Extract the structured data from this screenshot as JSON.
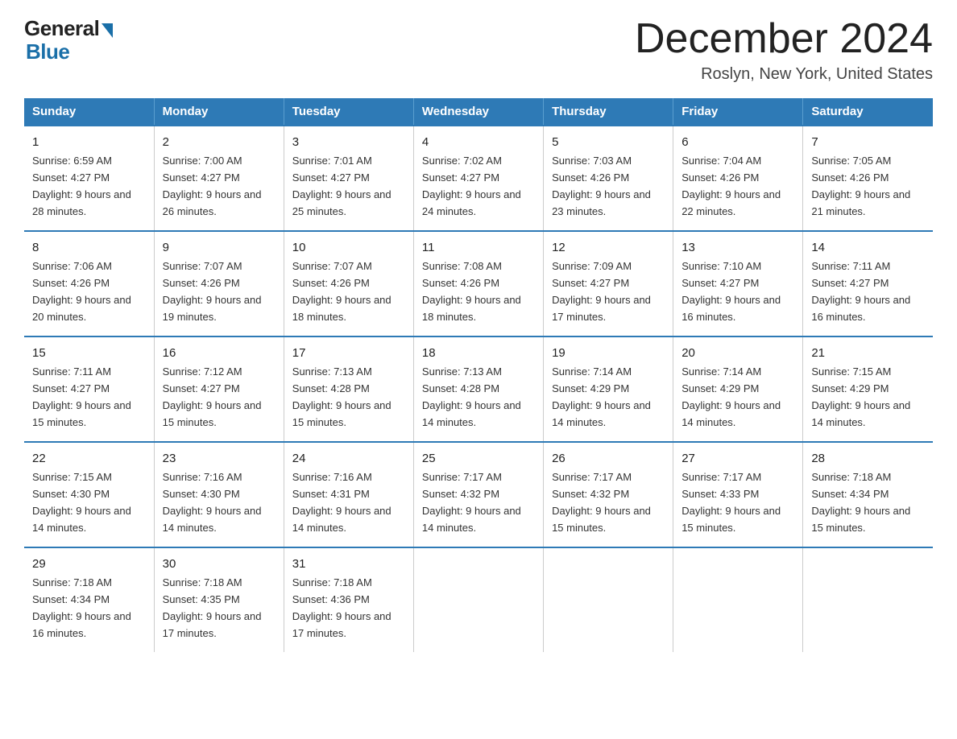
{
  "logo": {
    "text_general": "General",
    "text_blue": "Blue"
  },
  "title": "December 2024",
  "subtitle": "Roslyn, New York, United States",
  "days_of_week": [
    "Sunday",
    "Monday",
    "Tuesday",
    "Wednesday",
    "Thursday",
    "Friday",
    "Saturday"
  ],
  "weeks": [
    [
      {
        "day": "1",
        "sunrise": "Sunrise: 6:59 AM",
        "sunset": "Sunset: 4:27 PM",
        "daylight": "Daylight: 9 hours and 28 minutes."
      },
      {
        "day": "2",
        "sunrise": "Sunrise: 7:00 AM",
        "sunset": "Sunset: 4:27 PM",
        "daylight": "Daylight: 9 hours and 26 minutes."
      },
      {
        "day": "3",
        "sunrise": "Sunrise: 7:01 AM",
        "sunset": "Sunset: 4:27 PM",
        "daylight": "Daylight: 9 hours and 25 minutes."
      },
      {
        "day": "4",
        "sunrise": "Sunrise: 7:02 AM",
        "sunset": "Sunset: 4:27 PM",
        "daylight": "Daylight: 9 hours and 24 minutes."
      },
      {
        "day": "5",
        "sunrise": "Sunrise: 7:03 AM",
        "sunset": "Sunset: 4:26 PM",
        "daylight": "Daylight: 9 hours and 23 minutes."
      },
      {
        "day": "6",
        "sunrise": "Sunrise: 7:04 AM",
        "sunset": "Sunset: 4:26 PM",
        "daylight": "Daylight: 9 hours and 22 minutes."
      },
      {
        "day": "7",
        "sunrise": "Sunrise: 7:05 AM",
        "sunset": "Sunset: 4:26 PM",
        "daylight": "Daylight: 9 hours and 21 minutes."
      }
    ],
    [
      {
        "day": "8",
        "sunrise": "Sunrise: 7:06 AM",
        "sunset": "Sunset: 4:26 PM",
        "daylight": "Daylight: 9 hours and 20 minutes."
      },
      {
        "day": "9",
        "sunrise": "Sunrise: 7:07 AM",
        "sunset": "Sunset: 4:26 PM",
        "daylight": "Daylight: 9 hours and 19 minutes."
      },
      {
        "day": "10",
        "sunrise": "Sunrise: 7:07 AM",
        "sunset": "Sunset: 4:26 PM",
        "daylight": "Daylight: 9 hours and 18 minutes."
      },
      {
        "day": "11",
        "sunrise": "Sunrise: 7:08 AM",
        "sunset": "Sunset: 4:26 PM",
        "daylight": "Daylight: 9 hours and 18 minutes."
      },
      {
        "day": "12",
        "sunrise": "Sunrise: 7:09 AM",
        "sunset": "Sunset: 4:27 PM",
        "daylight": "Daylight: 9 hours and 17 minutes."
      },
      {
        "day": "13",
        "sunrise": "Sunrise: 7:10 AM",
        "sunset": "Sunset: 4:27 PM",
        "daylight": "Daylight: 9 hours and 16 minutes."
      },
      {
        "day": "14",
        "sunrise": "Sunrise: 7:11 AM",
        "sunset": "Sunset: 4:27 PM",
        "daylight": "Daylight: 9 hours and 16 minutes."
      }
    ],
    [
      {
        "day": "15",
        "sunrise": "Sunrise: 7:11 AM",
        "sunset": "Sunset: 4:27 PM",
        "daylight": "Daylight: 9 hours and 15 minutes."
      },
      {
        "day": "16",
        "sunrise": "Sunrise: 7:12 AM",
        "sunset": "Sunset: 4:27 PM",
        "daylight": "Daylight: 9 hours and 15 minutes."
      },
      {
        "day": "17",
        "sunrise": "Sunrise: 7:13 AM",
        "sunset": "Sunset: 4:28 PM",
        "daylight": "Daylight: 9 hours and 15 minutes."
      },
      {
        "day": "18",
        "sunrise": "Sunrise: 7:13 AM",
        "sunset": "Sunset: 4:28 PM",
        "daylight": "Daylight: 9 hours and 14 minutes."
      },
      {
        "day": "19",
        "sunrise": "Sunrise: 7:14 AM",
        "sunset": "Sunset: 4:29 PM",
        "daylight": "Daylight: 9 hours and 14 minutes."
      },
      {
        "day": "20",
        "sunrise": "Sunrise: 7:14 AM",
        "sunset": "Sunset: 4:29 PM",
        "daylight": "Daylight: 9 hours and 14 minutes."
      },
      {
        "day": "21",
        "sunrise": "Sunrise: 7:15 AM",
        "sunset": "Sunset: 4:29 PM",
        "daylight": "Daylight: 9 hours and 14 minutes."
      }
    ],
    [
      {
        "day": "22",
        "sunrise": "Sunrise: 7:15 AM",
        "sunset": "Sunset: 4:30 PM",
        "daylight": "Daylight: 9 hours and 14 minutes."
      },
      {
        "day": "23",
        "sunrise": "Sunrise: 7:16 AM",
        "sunset": "Sunset: 4:30 PM",
        "daylight": "Daylight: 9 hours and 14 minutes."
      },
      {
        "day": "24",
        "sunrise": "Sunrise: 7:16 AM",
        "sunset": "Sunset: 4:31 PM",
        "daylight": "Daylight: 9 hours and 14 minutes."
      },
      {
        "day": "25",
        "sunrise": "Sunrise: 7:17 AM",
        "sunset": "Sunset: 4:32 PM",
        "daylight": "Daylight: 9 hours and 14 minutes."
      },
      {
        "day": "26",
        "sunrise": "Sunrise: 7:17 AM",
        "sunset": "Sunset: 4:32 PM",
        "daylight": "Daylight: 9 hours and 15 minutes."
      },
      {
        "day": "27",
        "sunrise": "Sunrise: 7:17 AM",
        "sunset": "Sunset: 4:33 PM",
        "daylight": "Daylight: 9 hours and 15 minutes."
      },
      {
        "day": "28",
        "sunrise": "Sunrise: 7:18 AM",
        "sunset": "Sunset: 4:34 PM",
        "daylight": "Daylight: 9 hours and 15 minutes."
      }
    ],
    [
      {
        "day": "29",
        "sunrise": "Sunrise: 7:18 AM",
        "sunset": "Sunset: 4:34 PM",
        "daylight": "Daylight: 9 hours and 16 minutes."
      },
      {
        "day": "30",
        "sunrise": "Sunrise: 7:18 AM",
        "sunset": "Sunset: 4:35 PM",
        "daylight": "Daylight: 9 hours and 17 minutes."
      },
      {
        "day": "31",
        "sunrise": "Sunrise: 7:18 AM",
        "sunset": "Sunset: 4:36 PM",
        "daylight": "Daylight: 9 hours and 17 minutes."
      },
      {
        "day": "",
        "sunrise": "",
        "sunset": "",
        "daylight": ""
      },
      {
        "day": "",
        "sunrise": "",
        "sunset": "",
        "daylight": ""
      },
      {
        "day": "",
        "sunrise": "",
        "sunset": "",
        "daylight": ""
      },
      {
        "day": "",
        "sunrise": "",
        "sunset": "",
        "daylight": ""
      }
    ]
  ]
}
